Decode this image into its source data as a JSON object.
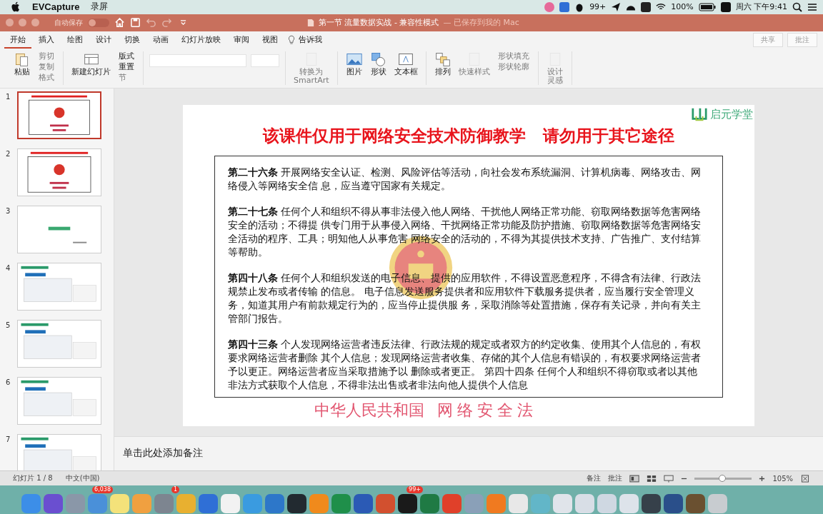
{
  "menubar": {
    "app": "EVCapture",
    "menu": "录屏",
    "notification_count": "99+",
    "battery": "100%",
    "clock": "周六 下午9:41"
  },
  "titlebar": {
    "autosave_label": "自动保存",
    "autosave_on": false,
    "title": "第一节 流量数据实战  -  兼容性模式",
    "status": "— 已保存到我的 Mac",
    "buttons": [
      "共享",
      "批注"
    ]
  },
  "tabs": [
    {
      "label": "开始",
      "selected": true
    },
    {
      "label": "插入",
      "selected": false
    },
    {
      "label": "绘图",
      "selected": false
    },
    {
      "label": "设计",
      "selected": false
    },
    {
      "label": "切换",
      "selected": false
    },
    {
      "label": "动画",
      "selected": false
    },
    {
      "label": "幻灯片放映",
      "selected": false
    },
    {
      "label": "审阅",
      "selected": false
    },
    {
      "label": "视图",
      "selected": false
    }
  ],
  "tell_me": "告诉我",
  "ribbon": [
    {
      "items": [
        {
          "kind": "paste",
          "label": "粘贴",
          "disabled": false
        }
      ],
      "small": [
        {
          "label": "剪切",
          "disabled": true
        },
        {
          "label": "复制",
          "disabled": true
        },
        {
          "label": "格式",
          "disabled": true
        }
      ]
    },
    {
      "items": [
        {
          "kind": "slide",
          "label": "新建幻灯片",
          "disabled": false
        }
      ],
      "small": [
        {
          "label": "版式",
          "disabled": false
        },
        {
          "label": "重置",
          "disabled": false
        },
        {
          "label": "节",
          "disabled": true
        }
      ]
    },
    {
      "items": [
        {
          "kind": "font"
        }
      ]
    },
    {
      "items": [
        {
          "kind": "smartart",
          "label": "转换为\nSmartArt",
          "disabled": true
        }
      ]
    },
    {
      "items": [
        {
          "kind": "picture",
          "label": "图片",
          "disabled": false
        },
        {
          "kind": "shape",
          "label": "形状",
          "disabled": false
        },
        {
          "kind": "textbox",
          "label": "文本框",
          "disabled": false
        }
      ]
    },
    {
      "items": [
        {
          "kind": "arrange",
          "label": "排列",
          "disabled": false
        },
        {
          "kind": "style",
          "label": "快速样式",
          "disabled": true
        }
      ],
      "small": [
        {
          "label": "形状填充",
          "disabled": true
        },
        {
          "label": "形状轮廓",
          "disabled": true
        }
      ]
    },
    {
      "items": [
        {
          "kind": "design",
          "label": "设计灵感",
          "disabled": true
        }
      ]
    }
  ],
  "thumbnails": [
    {
      "number": "1",
      "selected": true,
      "kind": "law"
    },
    {
      "number": "2",
      "selected": false,
      "kind": "law"
    },
    {
      "number": "3",
      "selected": false,
      "kind": "title"
    },
    {
      "number": "4",
      "selected": false,
      "kind": "screen"
    },
    {
      "number": "5",
      "selected": false,
      "kind": "screen"
    },
    {
      "number": "6",
      "selected": false,
      "kind": "screen"
    },
    {
      "number": "7",
      "selected": false,
      "kind": "screen"
    }
  ],
  "slide": {
    "logo": "启元学堂",
    "title": "该课件仅用于网络安全技术防御教学   请勿用于其它途径",
    "watermark": [
      "中华人民共和国",
      "网络安全法"
    ],
    "articles": [
      "**第二十六条** 开展网络安全认证、检测、风险评估等活动，向社会发布系统漏洞、计算机病毒、网络攻击、网络侵入等网络安全信 息，应当遵守国家有关规定。",
      "**第二十七条** 任何个人和组织不得从事非法侵入他人网络、干扰他人网络正常功能、窃取网络数据等危害网络安全的活动；不得提 供专门用于从事侵入网络、干扰网络正常功能及防护措施、窃取网络数据等危害网络安全活动的程序、工具；明知他人从事危害 网络安全的活动的，不得为其提供技术支持、广告推广、支付结算等帮助。",
      "**第四十八条** 任何个人和组织发送的电子信息、提供的应用软件，不得设置恶意程序，不得含有法律、行政法规禁止发布或者传输 的信息。 电子信息发送服务提供者和应用软件下载服务提供者，应当履行安全管理义务，知道其用户有前款规定行为的，应当停止提供服 务，采取消除等处置措施，保存有关记录，并向有关主管部门报告。",
      "**第四十三条** 个人发现网络运营者违反法律、行政法规的规定或者双方的约定收集、使用其个人信息的，有权要求网络运营者删除 其个人信息；发现网络运营者收集、存储的其个人信息有错误的，有权要求网络运营者予以更正。网络运营者应当采取措施予以 删除或者更正。 第四十四条  任何个人和组织不得窃取或者以其他非法方式获取个人信息，不得非法出售或者非法向他人提供个人信息"
    ]
  },
  "notes_placeholder": "单击此处添加备注",
  "status_bar": {
    "slide_count": "幻灯片 1 / 8",
    "language": "中文(中国)",
    "notes": "备注",
    "comments": "批注",
    "zoom": {
      "level": 0.48
    },
    "zoom_value": "105%"
  },
  "dock": [
    {
      "color": "#3c8ee8"
    },
    {
      "color": "#6a4fd0"
    },
    {
      "color": "#8a97a8"
    },
    {
      "color": "#4a90d9",
      "badge": "6,038"
    },
    {
      "color": "#f4e27a"
    },
    {
      "color": "#f0a040"
    },
    {
      "color": "#7d8590",
      "badge": "1"
    },
    {
      "color": "#e8b030"
    },
    {
      "color": "#2f6fd6"
    },
    {
      "color": "#f2f2f2"
    },
    {
      "color": "#3a9be0"
    },
    {
      "color": "#2d77c9"
    },
    {
      "color": "#222a30"
    },
    {
      "color": "#f08a1c"
    },
    {
      "color": "#1f8f4a"
    },
    {
      "color": "#2b5ab5"
    },
    {
      "color": "#d2502f"
    },
    {
      "color": "#1a1a1a",
      "badge": "99+"
    },
    {
      "color": "#1f7a44"
    },
    {
      "color": "#e0402a"
    },
    {
      "color": "#8aa0b8"
    },
    {
      "color": "#f07a20"
    },
    {
      "color": "#e8e8e8"
    },
    {
      "color": "#62b6c8"
    },
    {
      "color": "#e0e4ea"
    },
    {
      "color": "#d8dee6"
    },
    {
      "color": "#cfd8e2"
    },
    {
      "color": "#dde3ea"
    },
    {
      "color": "#36404a"
    },
    {
      "color": "#2a4f8a"
    },
    {
      "color": "#6a5030"
    },
    {
      "color": "#c8ccd0"
    }
  ]
}
